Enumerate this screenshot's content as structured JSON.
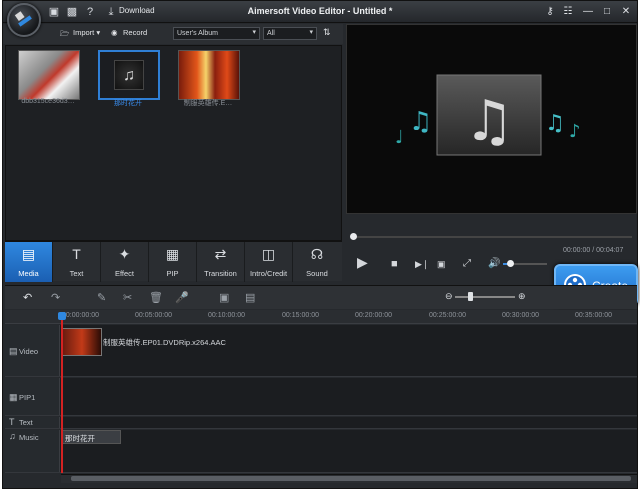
{
  "app": {
    "title": "Aimersoft Video Editor - Untitled *",
    "download_label": "Download"
  },
  "colors": {
    "accent": "#2f88e0",
    "playhead": "#d42222",
    "background": "#26292d"
  },
  "media_toolbar": {
    "import_label": "Import",
    "record_label": "Record",
    "album_select": "User's Album",
    "filter_select": "All"
  },
  "library": {
    "items": [
      {
        "label": "dbb315ce36d3…",
        "icon": "photo-thumbnail"
      },
      {
        "label": "那时花开",
        "icon": "music-thumbnail"
      },
      {
        "label": "制服英雄传.E…",
        "icon": "video-thumbnail"
      }
    ]
  },
  "categories": [
    {
      "label": "Media",
      "icon": "media-icon"
    },
    {
      "label": "Text",
      "icon": "text-icon"
    },
    {
      "label": "Effect",
      "icon": "effect-icon"
    },
    {
      "label": "PIP",
      "icon": "pip-icon"
    },
    {
      "label": "Transition",
      "icon": "transition-icon"
    },
    {
      "label": "Intro/Credit",
      "icon": "intro-credit-icon"
    },
    {
      "label": "Sound",
      "icon": "sound-icon"
    }
  ],
  "player": {
    "timecode": "00:00:00 / 00:04:07",
    "volume_level": 0.2
  },
  "create_label": "Create",
  "ruler": {
    "ticks": [
      "00:00:00:00",
      "00:05:00:00",
      "00:10:00:00",
      "00:15:00:00",
      "00:20:00:00",
      "00:25:00:00",
      "00:30:00:00",
      "00:35:00:00"
    ]
  },
  "tracks": {
    "video_label": "Video",
    "pip_label": "PIP1",
    "text_label": "Text",
    "music_label": "Music",
    "video_clip_text": "制服英雄传.EP01.DVDRip.x264.AAC",
    "music_clip_text": "那时花开"
  }
}
